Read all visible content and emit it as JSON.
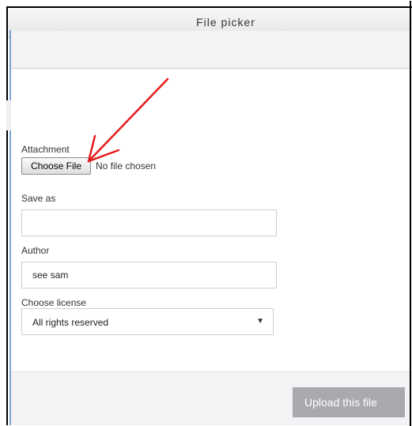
{
  "window": {
    "title": "File picker"
  },
  "form": {
    "attachment_label": "Attachment",
    "choose_file_label": "Choose File",
    "no_file_text": "No file chosen",
    "save_as_label": "Save as",
    "save_as_value": "",
    "author_label": "Author",
    "author_value": "see sam",
    "license_label": "Choose license",
    "license_value": "All rights reserved"
  },
  "footer": {
    "upload_label": "Upload this file"
  },
  "annotation": {
    "arrow_color": "#e31b1b"
  },
  "colors": {
    "rail": "#7da2d6",
    "upload_button": "#a8aaad"
  }
}
